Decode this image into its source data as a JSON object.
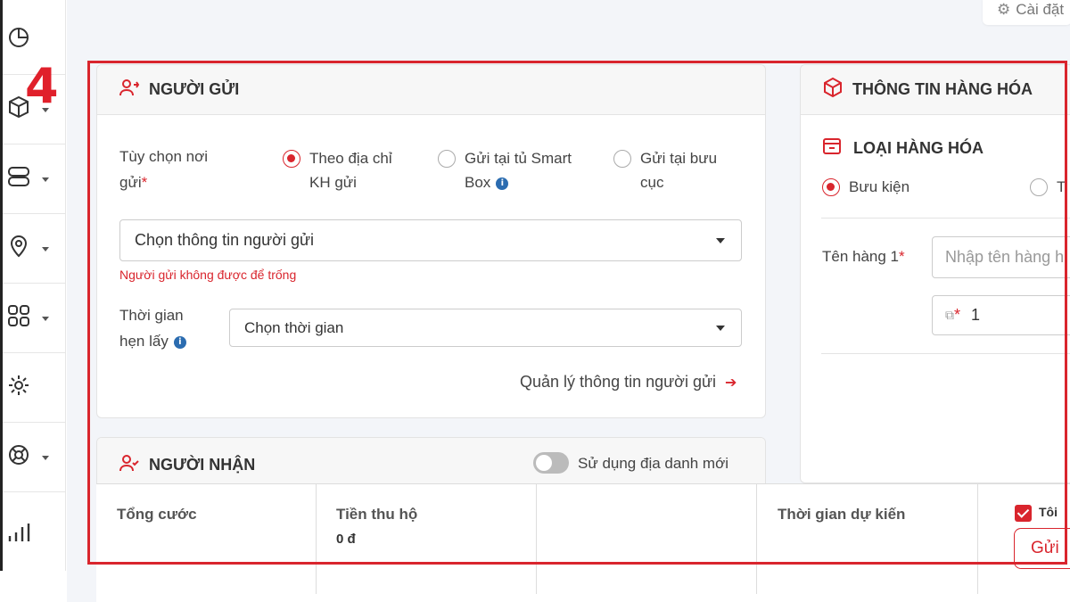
{
  "rail": {
    "items": [
      {
        "icon": "pie-chart-icon",
        "has_caret": false
      },
      {
        "icon": "box-icon",
        "has_caret": true
      },
      {
        "icon": "server-icon",
        "has_caret": true
      },
      {
        "icon": "location-pin-icon",
        "has_caret": true
      },
      {
        "icon": "grid-icon",
        "has_caret": true
      },
      {
        "icon": "gear-icon",
        "has_caret": false
      },
      {
        "icon": "lifebuoy-icon",
        "has_caret": true
      },
      {
        "icon": "bar-chart-icon",
        "has_caret": false
      }
    ]
  },
  "header": {
    "settings_label": "Cài đặt"
  },
  "annotation": {
    "step_number": "4",
    "highlight_color": "#d9252d"
  },
  "sender": {
    "title": "NGƯỜI GỬI",
    "pickup_option_label_line1": "Tùy chọn nơi",
    "pickup_option_label_line2": "gửi",
    "pickup_option_required": "*",
    "options": [
      {
        "line1": "Theo địa chỉ",
        "line2": "KH gửi",
        "selected": true
      },
      {
        "line1": "Gửi tại tủ Smart",
        "line2": "Box",
        "selected": false
      },
      {
        "line1": "Gửi tại bưu",
        "line2": "cục",
        "selected": false
      }
    ],
    "sender_select_value": "Chọn thông tin người gửi",
    "sender_error": "Người gửi không được để trống",
    "pickup_time_label_line1": "Thời gian",
    "pickup_time_label_line2": "hẹn lấy",
    "pickup_time_value": "Chọn thời gian",
    "manage_link": "Quản lý thông tin người gửi"
  },
  "receiver": {
    "title": "NGƯỜI NHẬN",
    "toggle_label": "Sử dụng địa danh mới",
    "toggle_on": false
  },
  "goods": {
    "title": "THÔNG TIN HÀNG HÓA",
    "type_title": "LOẠI HÀNG HÓA",
    "type_options": [
      {
        "label": "Bưu kiện",
        "selected": true
      },
      {
        "label": "T",
        "selected": false
      }
    ],
    "item_name_label": "Tên hàng 1",
    "item_name_required": "*",
    "item_name_placeholder": "Nhập tên hàng h",
    "quantity_required": "*",
    "quantity_value": "1"
  },
  "summary": {
    "total_fee_label": "Tổng cước",
    "cod_label": "Tiền thu hộ",
    "cod_value": "0 đ",
    "eta_label": "Thời gian dự kiến",
    "agree_label": "Tôi",
    "agree_checked": true,
    "send_button": "Gửi"
  },
  "colors": {
    "accent": "#d9252d",
    "info": "#2b6cb0"
  }
}
